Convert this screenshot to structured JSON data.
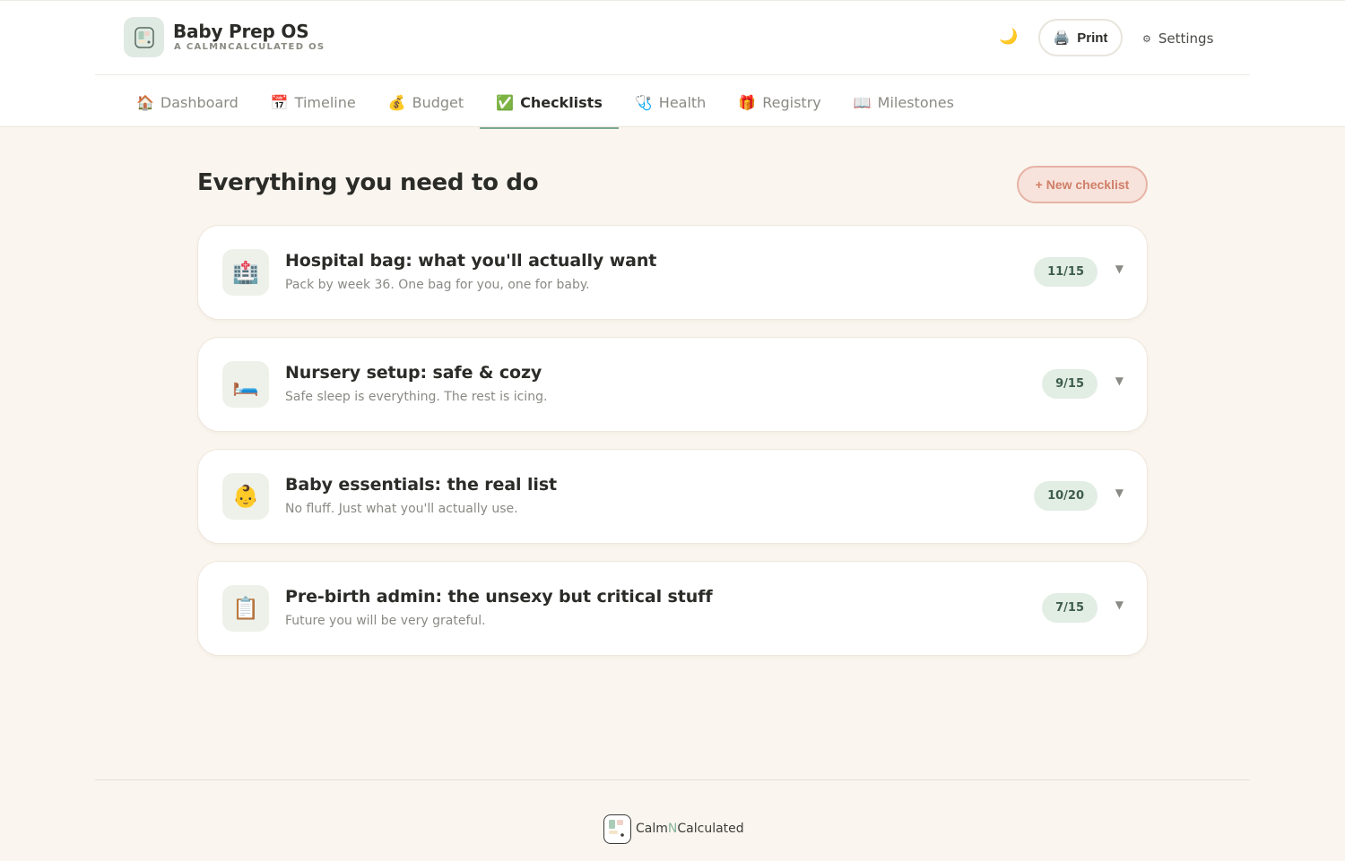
{
  "app": {
    "title": "Baby Prep OS",
    "subtitle": "A CALMNCALCULATED OS"
  },
  "header": {
    "theme_icon": "moon-icon",
    "print_label": "Print",
    "settings_label": "Settings"
  },
  "tabs": [
    {
      "icon": "🏠",
      "label": "Dashboard",
      "active": false
    },
    {
      "icon": "📅",
      "label": "Timeline",
      "active": false
    },
    {
      "icon": "💰",
      "label": "Budget",
      "active": false
    },
    {
      "icon": "✅",
      "label": "Checklists",
      "active": true
    },
    {
      "icon": "🩺",
      "label": "Health",
      "active": false
    },
    {
      "icon": "🎁",
      "label": "Registry",
      "active": false
    },
    {
      "icon": "📖",
      "label": "Milestones",
      "active": false
    }
  ],
  "main": {
    "title": "Everything you need to do",
    "new_button": "+ New checklist",
    "checklists": [
      {
        "icon": "🏥",
        "title": "Hospital bag: what you'll actually want",
        "subtitle": "Pack by week 36. One bag for you, one for baby.",
        "progress": "11/15"
      },
      {
        "icon": "🛏️",
        "title": "Nursery setup: safe & cozy",
        "subtitle": "Safe sleep is everything. The rest is icing.",
        "progress": "9/15"
      },
      {
        "icon": "👶",
        "title": "Baby essentials: the real list",
        "subtitle": "No fluff. Just what you'll actually use.",
        "progress": "10/20"
      },
      {
        "icon": "📋",
        "title": "Pre-birth admin: the unsexy but critical stuff",
        "subtitle": "Future you will be very grateful.",
        "progress": "7/15"
      }
    ]
  },
  "footer": {
    "brand_part1": "Calm",
    "brand_part2": "N",
    "brand_part3": "Calculated"
  },
  "colors": {
    "background": "#faf6ef",
    "accent_green": "#7aa894",
    "badge_bg": "#e2ede4",
    "new_button_bg": "#f7e3db",
    "new_button_text": "#d07e68"
  }
}
